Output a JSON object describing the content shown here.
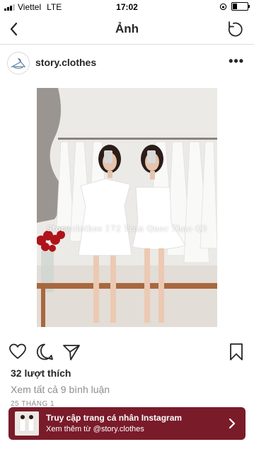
{
  "status_bar": {
    "carrier": "Viettel",
    "network": "LTE",
    "time": "17:02",
    "battery_level": 0.3
  },
  "nav": {
    "title": "Ảnh",
    "back_icon": "chevron-left-icon",
    "refresh_icon": "refresh-icon"
  },
  "post": {
    "username": "story.clothes",
    "more_icon": "more-dots-icon",
    "photo_watermark": "Story.clothes 172 Tran Quoc Thao Q3",
    "likes": "32 lượt thích",
    "view_comments": "Xem tất cả 9 bình luận",
    "date": "25 THÁNG 1"
  },
  "banner": {
    "title": "Truy cập trang cá nhân Instagram",
    "subtitle": "Xem thêm từ @story.clothes",
    "background_color": "#7a1b2a"
  }
}
